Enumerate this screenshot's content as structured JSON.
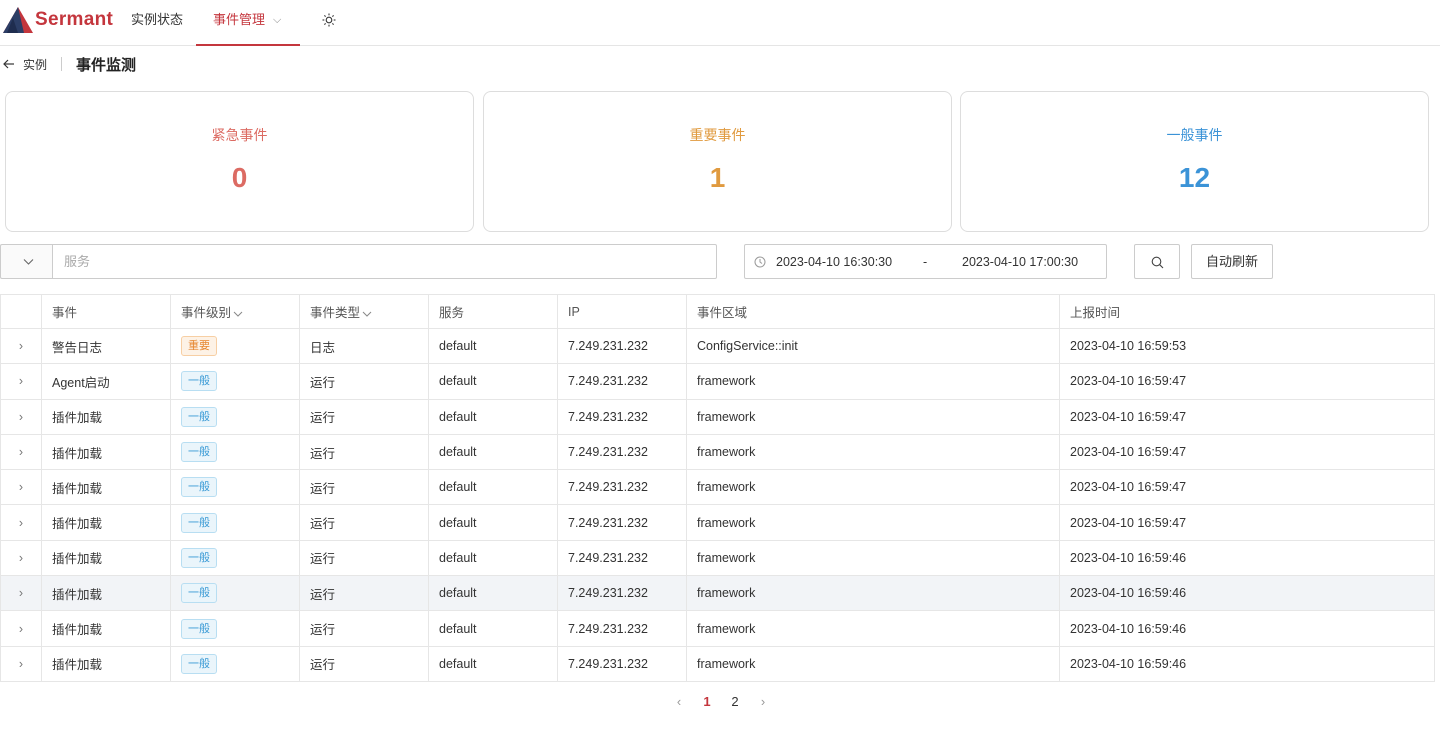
{
  "nav": {
    "brand": "Sermant",
    "instances": "实例状态",
    "events": "事件管理",
    "theme_icon": "sun-icon"
  },
  "breadcrumb": {
    "back": "实例",
    "title": "事件监测"
  },
  "stats": [
    {
      "label": "紧急事件",
      "value": "0",
      "color": "#dc6b63"
    },
    {
      "label": "重要事件",
      "value": "1",
      "color": "#e09a3f"
    },
    {
      "label": "一般事件",
      "value": "12",
      "color": "#3b93d7"
    }
  ],
  "filter": {
    "service_placeholder": "服务",
    "date_start": "2023-04-10 16:30:30",
    "date_separator": "-",
    "date_end": "2023-04-10 17:00:30",
    "refresh_label": "自动刷新"
  },
  "table": {
    "columns": [
      "事件",
      "事件级别",
      "事件类型",
      "服务",
      "IP",
      "事件区域",
      "上报时间"
    ],
    "rows": [
      {
        "event": "警告日志",
        "level": "重要",
        "level_kind": "imp",
        "type": "日志",
        "service": "default",
        "ip": "7.249.231.232",
        "area": "ConfigService::init",
        "time": "2023-04-10 16:59:53"
      },
      {
        "event": "Agent启动",
        "level": "一般",
        "level_kind": "gen",
        "type": "运行",
        "service": "default",
        "ip": "7.249.231.232",
        "area": "framework",
        "time": "2023-04-10 16:59:47"
      },
      {
        "event": "插件加载",
        "level": "一般",
        "level_kind": "gen",
        "type": "运行",
        "service": "default",
        "ip": "7.249.231.232",
        "area": "framework",
        "time": "2023-04-10 16:59:47"
      },
      {
        "event": "插件加载",
        "level": "一般",
        "level_kind": "gen",
        "type": "运行",
        "service": "default",
        "ip": "7.249.231.232",
        "area": "framework",
        "time": "2023-04-10 16:59:47"
      },
      {
        "event": "插件加载",
        "level": "一般",
        "level_kind": "gen",
        "type": "运行",
        "service": "default",
        "ip": "7.249.231.232",
        "area": "framework",
        "time": "2023-04-10 16:59:47"
      },
      {
        "event": "插件加载",
        "level": "一般",
        "level_kind": "gen",
        "type": "运行",
        "service": "default",
        "ip": "7.249.231.232",
        "area": "framework",
        "time": "2023-04-10 16:59:47"
      },
      {
        "event": "插件加载",
        "level": "一般",
        "level_kind": "gen",
        "type": "运行",
        "service": "default",
        "ip": "7.249.231.232",
        "area": "framework",
        "time": "2023-04-10 16:59:46"
      },
      {
        "event": "插件加载",
        "level": "一般",
        "level_kind": "gen",
        "type": "运行",
        "service": "default",
        "ip": "7.249.231.232",
        "area": "framework",
        "time": "2023-04-10 16:59:46"
      },
      {
        "event": "插件加载",
        "level": "一般",
        "level_kind": "gen",
        "type": "运行",
        "service": "default",
        "ip": "7.249.231.232",
        "area": "framework",
        "time": "2023-04-10 16:59:46"
      },
      {
        "event": "插件加载",
        "level": "一般",
        "level_kind": "gen",
        "type": "运行",
        "service": "default",
        "ip": "7.249.231.232",
        "area": "framework",
        "time": "2023-04-10 16:59:46"
      }
    ]
  },
  "pagination": {
    "pages": [
      "1",
      "2"
    ],
    "current": "1"
  }
}
